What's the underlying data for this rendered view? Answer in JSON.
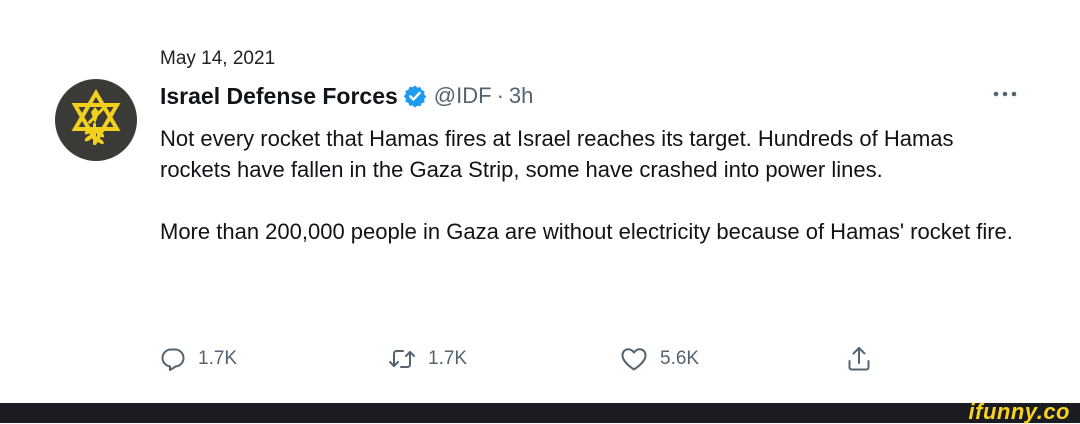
{
  "tweet": {
    "date": "May 14, 2021",
    "author": {
      "name": "Israel Defense Forces",
      "handle": "@IDF",
      "separator": "·",
      "time": "3h",
      "avatar_icon": "idf-emblem-icon",
      "verified_icon": "verified-badge-icon"
    },
    "text": {
      "paragraph_1": "Not every rocket that Hamas fires at Israel reaches its target. Hundreds of Hamas rockets have fallen in the Gaza Strip, some have crashed into power lines.",
      "paragraph_2": "More than 200,000 people in Gaza are without electricity because of Hamas' rocket fire."
    },
    "more_icon": "more-options-icon",
    "actions": {
      "reply": {
        "icon": "reply-icon",
        "count": "1.7K"
      },
      "retweet": {
        "icon": "retweet-icon",
        "count": "1.7K"
      },
      "like": {
        "icon": "like-icon",
        "count": "5.6K"
      },
      "share": {
        "icon": "share-icon"
      }
    }
  },
  "footer": {
    "watermark": "ifunny.co"
  },
  "colors": {
    "text_primary": "#0f1419",
    "text_secondary": "#536471",
    "verified_blue": "#1d9bf0",
    "avatar_bg": "#3a3b37",
    "emblem_yellow": "#f2d01c",
    "footer_bg": "#1b1c22",
    "watermark_yellow": "#f8d21b"
  }
}
